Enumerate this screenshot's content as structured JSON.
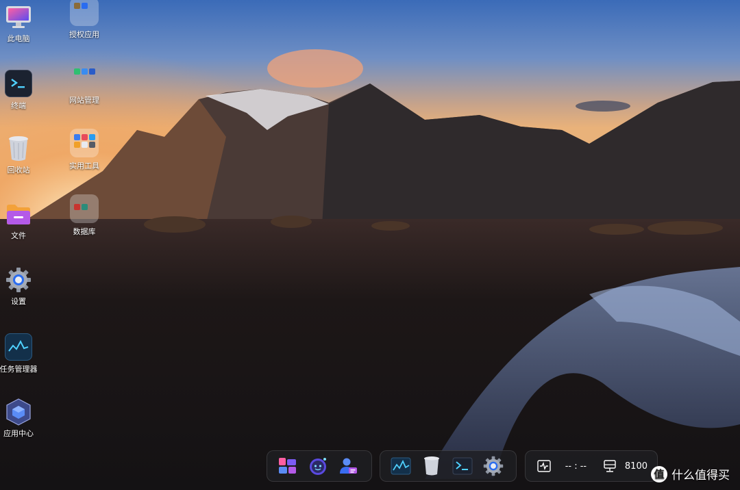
{
  "desktop": {
    "icons": [
      {
        "label": "此电脑"
      },
      {
        "label": "终端"
      },
      {
        "label": "回收站"
      },
      {
        "label": "文件"
      },
      {
        "label": "设置"
      },
      {
        "label": "任务管理器"
      },
      {
        "label": "应用中心"
      }
    ],
    "folders": [
      {
        "label": "授权应用"
      },
      {
        "label": "网站管理"
      },
      {
        "label": "实用工具"
      },
      {
        "label": "数据库"
      }
    ]
  },
  "taskbar": {
    "clock": "-- : --",
    "port": "8100"
  },
  "watermark": {
    "text": "什么值得买",
    "badge": "值"
  },
  "colors": {
    "accent": "#7c5cf5",
    "terminal_bg": "#1b2230",
    "terminal_fg": "#4fd1ff"
  }
}
